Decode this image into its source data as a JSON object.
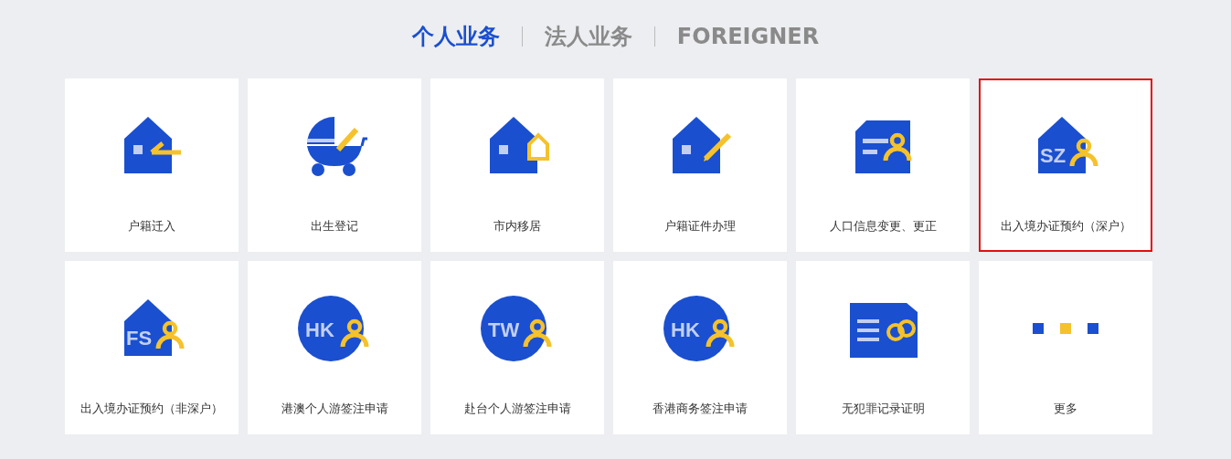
{
  "tabs": [
    {
      "label": "个人业务",
      "selected": true
    },
    {
      "label": "法人业务",
      "selected": false
    },
    {
      "label": "FOREIGNER",
      "selected": false
    }
  ],
  "cards": [
    {
      "label": "户籍迁入",
      "kind": "house-check",
      "selected": false
    },
    {
      "label": "出生登记",
      "kind": "stroller",
      "selected": false
    },
    {
      "label": "市内移居",
      "kind": "house-home",
      "selected": false
    },
    {
      "label": "户籍证件办理",
      "kind": "house-pencil",
      "selected": false
    },
    {
      "label": "人口信息变更、更正",
      "kind": "doc-person",
      "selected": false
    },
    {
      "label": "出入境办证预约（深户）",
      "kind": "house-person",
      "icon_text": "SZ",
      "selected": true
    },
    {
      "label": "出入境办证预约（非深户）",
      "kind": "house-person",
      "icon_text": "FS",
      "selected": false
    },
    {
      "label": "港澳个人游签注申请",
      "kind": "circle-person",
      "icon_text": "HK",
      "selected": false
    },
    {
      "label": "赴台个人游签注申请",
      "kind": "circle-person",
      "icon_text": "TW",
      "selected": false
    },
    {
      "label": "香港商务签注申请",
      "kind": "circle-person",
      "icon_text": "HK",
      "selected": false
    },
    {
      "label": "无犯罪记录证明",
      "kind": "doc-cuffs",
      "selected": false
    },
    {
      "label": "更多",
      "kind": "dots",
      "selected": false
    }
  ]
}
